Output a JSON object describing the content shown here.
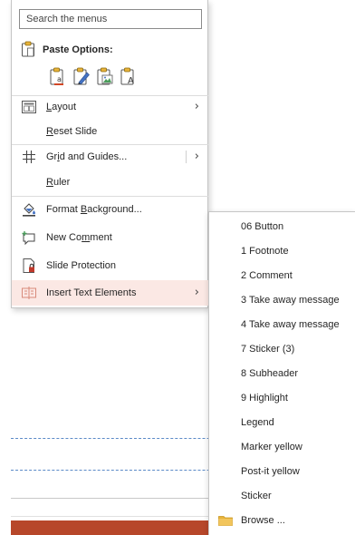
{
  "search": {
    "placeholder": "Search the menus"
  },
  "paste": {
    "label": "Paste Options:",
    "options": [
      "use-destination-theme-icon",
      "keep-source-formatting-icon",
      "picture-icon",
      "keep-text-only-icon"
    ]
  },
  "menu": {
    "layout": {
      "pre": "",
      "key": "L",
      "post": "ayout"
    },
    "reset_slide": {
      "pre": "",
      "key": "R",
      "post": "eset Slide"
    },
    "grid_guides": {
      "pre": "Gr",
      "key": "i",
      "post": "d and Guides..."
    },
    "ruler": {
      "pre": "",
      "key": "R",
      "post": "uler"
    },
    "format_background": {
      "pre": "Format ",
      "key": "B",
      "post": "ackground..."
    },
    "new_comment": {
      "pre": "New Co",
      "key": "m",
      "post": "ment"
    },
    "slide_protection": {
      "label": "Slide Protection"
    },
    "insert_text_elements": {
      "label": "Insert Text Elements"
    }
  },
  "submenu": {
    "items": [
      "06 Button",
      "1 Footnote",
      "2 Comment",
      "3 Take away message",
      "4 Take away message",
      "7 Sticker (3)",
      "8 Subheader",
      "9 Highlight",
      "Legend",
      "Marker yellow",
      "Post-it yellow",
      "Sticker"
    ],
    "browse": "Browse ..."
  },
  "colors": {
    "accent": "#b7472a",
    "highlight": "#fbe8e4",
    "guide": "#5b8ac7",
    "folder": "#e8b339"
  }
}
